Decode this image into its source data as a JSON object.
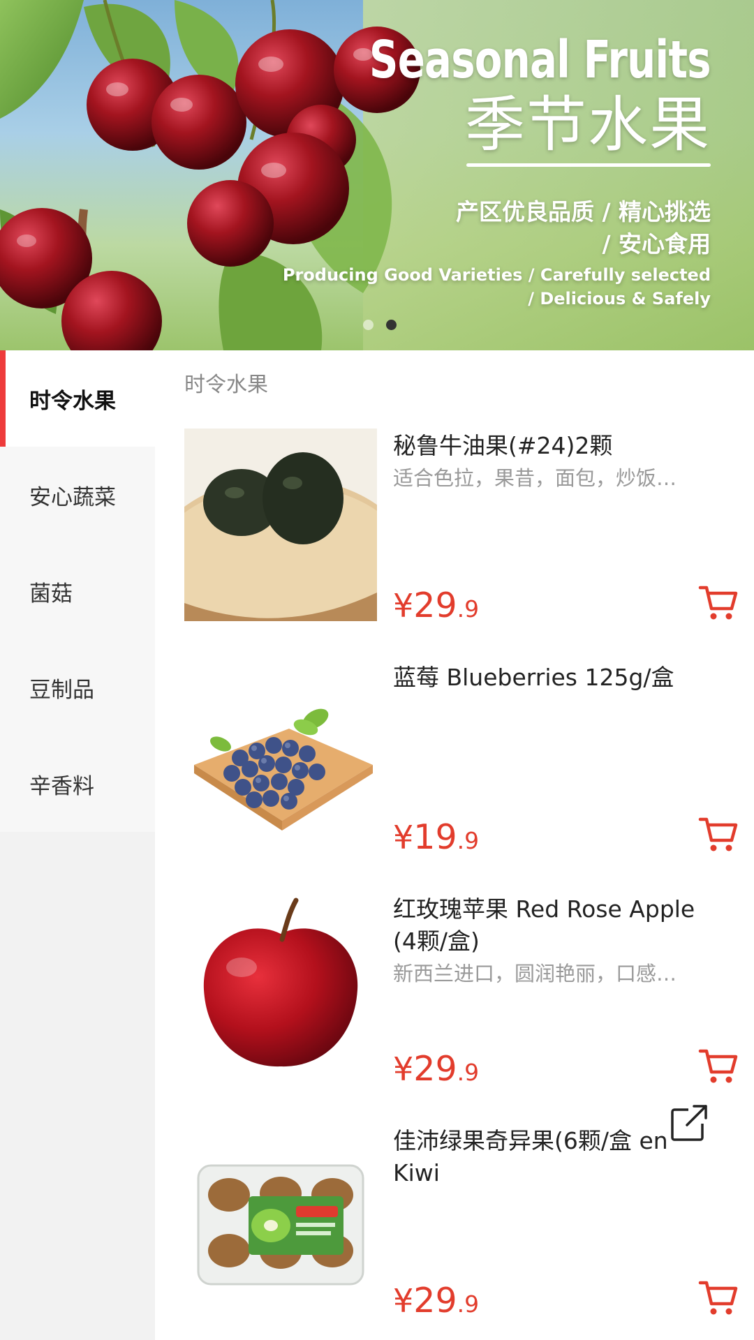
{
  "banner": {
    "title_en": "Seasonal Fruits",
    "title_cn": "季节水果",
    "subtitle_cn_line1": "产区优良品质 / 精心挑选",
    "subtitle_cn_line2": "/ 安心食用",
    "subtitle_en_line1": "Producing Good Varieties / Carefully selected",
    "subtitle_en_line2": "/ Delicious & Safely",
    "page_count": 2,
    "active_page": 2
  },
  "sidebar": {
    "items": [
      {
        "label": "时令水果",
        "active": true
      },
      {
        "label": "安心蔬菜",
        "active": false
      },
      {
        "label": "菌菇",
        "active": false
      },
      {
        "label": "豆制品",
        "active": false
      },
      {
        "label": "辛香料",
        "active": false
      }
    ]
  },
  "content": {
    "section_title": "时令水果",
    "currency": "¥",
    "products": [
      {
        "name": "秘鲁牛油果(#24)2颗",
        "desc": "适合色拉，果昔，面包，炒饭…",
        "price_int": "29",
        "price_dec": ".9",
        "image": "avocado"
      },
      {
        "name": "蓝莓 Blueberries 125g/盒",
        "desc": "",
        "price_int": "19",
        "price_dec": ".9",
        "image": "blueberries"
      },
      {
        "name": "红玫瑰苹果 Red Rose Apple (4颗/盒)",
        "desc": "新西兰进口，圆润艳丽，口感…",
        "price_int": "29",
        "price_dec": ".9",
        "image": "apple"
      },
      {
        "name": "佳沛绿果奇异果(6颗/盒 en Kiwi",
        "desc": "",
        "price_int": "29",
        "price_dec": ".9",
        "image": "kiwi-box"
      }
    ]
  },
  "icons": {
    "cart": "shopping-cart-icon",
    "share": "share-external-icon"
  },
  "colors": {
    "accent": "#ee3b3b",
    "price": "#e23c2c",
    "sidebar_bg": "#f2f2f2",
    "muted_text": "#999999"
  }
}
